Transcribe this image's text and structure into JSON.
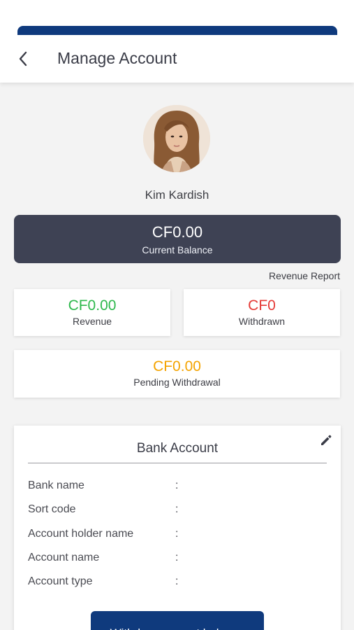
{
  "header": {
    "title": "Manage Account",
    "back_icon": "chevron-left-icon",
    "accent_color": "#0f3a7d"
  },
  "profile": {
    "name": "Kim Kardish"
  },
  "balance": {
    "amount": "CF0.00",
    "label": "Current Balance",
    "background": "#3e4254"
  },
  "revenue_report": {
    "label": "Revenue Report"
  },
  "stats": {
    "revenue": {
      "value": "CF0.00",
      "label": "Revenue",
      "color": "#2db84c"
    },
    "withdrawn": {
      "value": "CF0",
      "label": "Withdrawn",
      "color": "#e53935"
    },
    "pending": {
      "value": "CF0.00",
      "label": "Pending Withdrawal",
      "color": "#f4a300"
    }
  },
  "bank_account": {
    "title": "Bank Account",
    "edit_icon": "pencil-icon",
    "separator": ":",
    "fields": [
      {
        "label": "Bank name",
        "value": ""
      },
      {
        "label": "Sort code",
        "value": ""
      },
      {
        "label": "Account holder name",
        "value": ""
      },
      {
        "label": "Account name",
        "value": ""
      },
      {
        "label": "Account type",
        "value": ""
      }
    ],
    "withdraw_button": "Withdraw current balance"
  }
}
